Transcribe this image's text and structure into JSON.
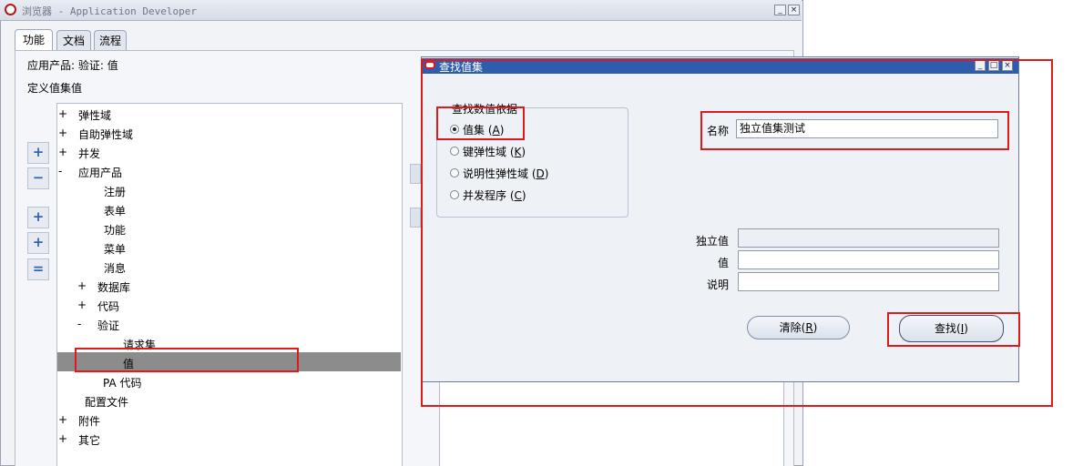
{
  "window": {
    "title": "浏览器 - Application Developer"
  },
  "tabs": [
    {
      "label": "功能",
      "active": true
    },
    {
      "label": "文档",
      "active": false
    },
    {
      "label": "流程",
      "active": false
    }
  ],
  "context": {
    "app_label": "应用产品: 验证: 值",
    "define_label": "定义值集值"
  },
  "tree": {
    "items": [
      {
        "prefix": "+",
        "label": "弹性域"
      },
      {
        "prefix": "+",
        "label": "自助弹性域"
      },
      {
        "prefix": "+",
        "label": "并发"
      },
      {
        "prefix": "-",
        "label": "应用产品"
      },
      {
        "prefix": "",
        "label": "注册"
      },
      {
        "prefix": "",
        "label": "表单"
      },
      {
        "prefix": "",
        "label": "功能"
      },
      {
        "prefix": "",
        "label": "菜单"
      },
      {
        "prefix": "",
        "label": "消息"
      },
      {
        "prefix": "+",
        "label": "数据库"
      },
      {
        "prefix": "+",
        "label": "代码"
      },
      {
        "prefix": "-",
        "label": "验证"
      },
      {
        "prefix": "",
        "label": "请求集"
      },
      {
        "prefix": "",
        "label": "值"
      },
      {
        "prefix": "",
        "label": "PA 代码"
      },
      {
        "prefix": "",
        "label": "配置文件"
      },
      {
        "prefix": "+",
        "label": "附件"
      },
      {
        "prefix": "+",
        "label": "其它"
      }
    ],
    "selected": "值"
  },
  "side_buttons": [
    {
      "icon": "expand-icon",
      "glyph": "+"
    },
    {
      "icon": "collapse-icon",
      "glyph": "−"
    },
    {
      "icon": "expand-branch-icon",
      "glyph": "+"
    },
    {
      "icon": "expand-all-icon",
      "glyph": "+"
    },
    {
      "icon": "collapse-all-icon",
      "glyph": "="
    }
  ],
  "dialog": {
    "title": "查找值集",
    "group_title": "查找数值依据",
    "options": [
      {
        "label": "值集",
        "key": "A",
        "selected": true
      },
      {
        "label": "键弹性域",
        "key": "K",
        "selected": false
      },
      {
        "label": "说明性弹性域",
        "key": "D",
        "selected": false
      },
      {
        "label": "并发程序",
        "key": "C",
        "selected": false
      }
    ],
    "name_label": "名称",
    "name_value": "独立值集测试",
    "independent_label": "独立值",
    "independent_value": "",
    "value_label": "值",
    "value_value": "",
    "desc_label": "说明",
    "desc_value": "",
    "clear_button": {
      "label": "清除",
      "key": "R"
    },
    "find_button": {
      "label": "查找",
      "key": "I"
    }
  },
  "colors": {
    "title_bar": "#2e5dae",
    "highlight": "#e0191b",
    "selection": "#8c8c8c"
  }
}
